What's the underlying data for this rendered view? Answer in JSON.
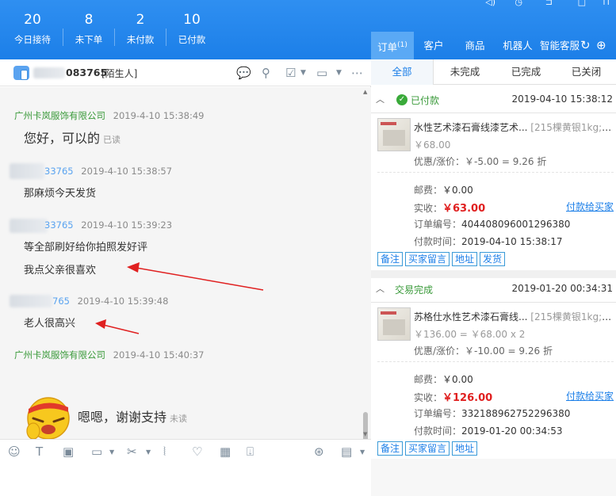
{
  "stats": [
    {
      "num": "20",
      "label": "今日接待"
    },
    {
      "num": "8",
      "label": "未下单"
    },
    {
      "num": "2",
      "label": "未付款"
    },
    {
      "num": "10",
      "label": "已付款"
    }
  ],
  "right_tabs": [
    {
      "label": "订单",
      "badge": "(1)"
    },
    {
      "label": "客户"
    },
    {
      "label": "商品"
    },
    {
      "label": "机器人"
    },
    {
      "label": "智能客服"
    }
  ],
  "chat": {
    "user_id_suffix": "083765",
    "tag": "[陌生人]",
    "messages": [
      {
        "sender": "广州卡岚服饰有限公司",
        "time": "2019-4-10 15:38:49",
        "lines": [
          "您好，可以的"
        ],
        "read": "已读"
      },
      {
        "sender": "33765",
        "time": "2019-4-10 15:38:57",
        "lines": [
          "那麻烦今天发货"
        ]
      },
      {
        "sender": "33765",
        "time": "2019-4-10 15:39:23",
        "lines": [
          "等全部刷好给你拍照发好评",
          "我点父亲很喜欢"
        ]
      },
      {
        "sender": "765",
        "time": "2019-4-10 15:39:48",
        "lines": [
          "老人很高兴"
        ]
      },
      {
        "sender": "广州卡岚服饰有限公司",
        "time": "2019-4-10 15:40:37",
        "lines": [
          "嗯嗯，谢谢支持"
        ],
        "read": "未读"
      }
    ]
  },
  "order_tabs": [
    "全部",
    "未完成",
    "已完成",
    "已关闭"
  ],
  "orders": [
    {
      "status": "已付款",
      "date": "2019-04-10 15:38:12",
      "title": "水性艺术漆石膏线漆艺术...",
      "sku": "[215棵黄银1kg;1...",
      "price": "￥68.00",
      "discount_label": "优惠/涨价：",
      "discount": "￥-5.00 = 9.26 折",
      "postage_label": "邮费：",
      "postage": "￥0.00",
      "paid_label": "实收：",
      "paid": "￥63.00",
      "pay_link": "付款给买家",
      "order_no_label": "订单编号：",
      "order_no": "404408096001296380",
      "pay_time_label": "付款时间：",
      "pay_time": "2019-04-10 15:38:17",
      "buttons": [
        "备注",
        "买家留言",
        "地址",
        "发货"
      ]
    },
    {
      "status": "交易完成",
      "date": "2019-01-20 00:34:31",
      "title": "苏格仕水性艺术漆石膏线...",
      "sku": "[215棵黄银1kg;1...",
      "price": "￥136.00 = ￥68.00 x 2",
      "discount_label": "优惠/涨价：",
      "discount": "￥-10.00 = 9.26 折",
      "postage_label": "邮费：",
      "postage": "￥0.00",
      "paid_label": "实收：",
      "paid": "￥126.00",
      "pay_link": "付款给买家",
      "order_no_label": "订单编号：",
      "order_no": "332188962752296380",
      "pay_time_label": "付款时间：",
      "pay_time": "2019-01-20 00:34:53",
      "buttons": [
        "备注",
        "买家留言",
        "地址"
      ]
    }
  ],
  "colors": {
    "header": "#1c7fe8",
    "shop_name": "#3a9a3a",
    "price_red": "#e02020",
    "arrow": "#e02020"
  }
}
